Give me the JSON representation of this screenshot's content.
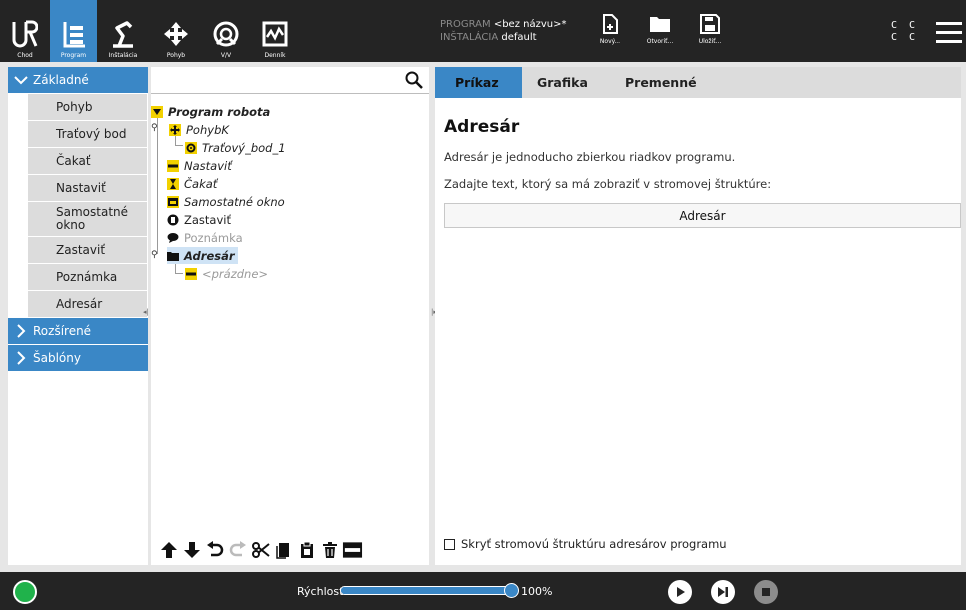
{
  "topbar": {
    "nav": [
      {
        "label": "Chod",
        "icon": "ur-logo-icon"
      },
      {
        "label": "Program",
        "icon": "program-icon"
      },
      {
        "label": "Inštalácia",
        "icon": "installation-icon"
      },
      {
        "label": "Pohyb",
        "icon": "move-icon"
      },
      {
        "label": "V/V",
        "icon": "io-icon"
      },
      {
        "label": "Denník",
        "icon": "log-icon"
      }
    ],
    "program_label": "PROGRAM",
    "program_value": "<bez názvu>*",
    "installation_label": "INŠTALÁCIA",
    "installation_value": "default",
    "file_buttons": [
      {
        "label": "Nový...",
        "icon": "new-file-icon"
      },
      {
        "label": "Otvoriť...",
        "icon": "open-folder-icon"
      },
      {
        "label": "Uložiť...",
        "icon": "save-icon"
      }
    ],
    "cc_top": "C C",
    "cc_bottom": "C C"
  },
  "left": {
    "basic": "Základné",
    "items": [
      "Pohyb",
      "Traťový bod",
      "Čakať",
      "Nastaviť",
      "Samostatné okno",
      "Zastaviť",
      "Poznámka",
      "Adresár"
    ],
    "advanced": "Rozšírené",
    "templates": "Šablóny"
  },
  "tree": {
    "root": "Program robota",
    "nodes": [
      {
        "label": "PohybK",
        "icon": "move-icon"
      },
      {
        "label": "Traťový_bod_1",
        "icon": "waypoint-icon"
      },
      {
        "label": "Nastaviť",
        "icon": "set-icon"
      },
      {
        "label": "Čakať",
        "icon": "wait-icon"
      },
      {
        "label": "Samostatné okno",
        "icon": "popup-icon"
      },
      {
        "label": "Zastaviť",
        "icon": "halt-icon"
      },
      {
        "label": "Poznámka",
        "icon": "comment-icon"
      },
      {
        "label": "Adresár",
        "icon": "folder-icon"
      },
      {
        "label": "<prázdne>",
        "icon": "empty-icon"
      }
    ],
    "toolbar": [
      "move-up-icon",
      "move-down-icon",
      "undo-icon",
      "redo-icon",
      "cut-icon",
      "copy-icon",
      "paste-icon",
      "delete-icon",
      "suppress-icon"
    ]
  },
  "right": {
    "tabs": [
      "Príkaz",
      "Grafika",
      "Premenné"
    ],
    "title": "Adresár",
    "text1": "Adresár je jednoducho zbierkou riadkov programu.",
    "text2": "Zadajte text, ktorý sa má zobraziť v stromovej štruktúre:",
    "input_value": "Adresár",
    "checkbox_label": "Skryť stromovú štruktúru adresárov programu",
    "checkbox_checked": false
  },
  "bottom": {
    "speed_label": "Rýchlosť",
    "speed_value": "100%",
    "speed_fraction": 1.0,
    "status_color": "#20b24b"
  },
  "colors": {
    "accent": "#3a87c6",
    "bar": "#242424"
  }
}
